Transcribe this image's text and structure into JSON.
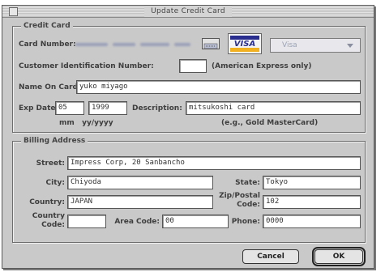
{
  "window": {
    "title": "Update Credit Card"
  },
  "credit_card": {
    "group_title": "Credit Card",
    "card_number_label": "Card Number:",
    "card_type_value": "Visa",
    "visa_logo_text": "VISA",
    "customer_id_label": "Customer Identification Number:",
    "customer_id_value": "",
    "customer_id_note": "(American Express only)",
    "name_label": "Name On Card:",
    "name_value": "yuko miyago",
    "exp_label": "Exp Date:",
    "exp_month": "05",
    "exp_year": "1999",
    "exp_hint": "mm   yy/yyyy",
    "description_label": "Description:",
    "description_value": "mitsukoshi card",
    "description_hint": "(e.g., Gold MasterCard)"
  },
  "billing": {
    "group_title": "Billing Address",
    "street_label": "Street:",
    "street_value": "Impress Corp, 20 Sanbancho",
    "city_label": "City:",
    "city_value": "Chiyoda",
    "state_label": "State:",
    "state_value": "Tokyo",
    "country_label": "Country:",
    "country_value": "JAPAN",
    "zip_label_1": "Zip/Postal",
    "zip_label_2": "Code:",
    "zip_value": "102",
    "country_code_label_1": "Country",
    "country_code_label_2": "Code:",
    "country_code_value": "",
    "area_code_label": "Area Code:",
    "area_code_value": "00",
    "phone_label": "Phone:",
    "phone_value": "0000"
  },
  "buttons": {
    "cancel": "Cancel",
    "ok": "OK"
  }
}
